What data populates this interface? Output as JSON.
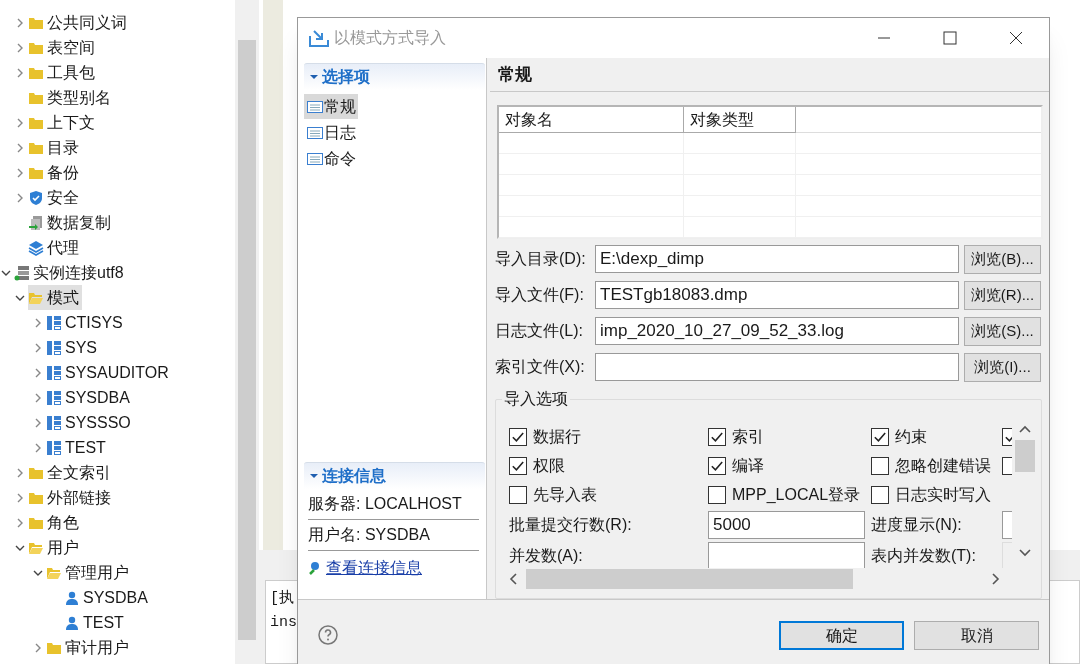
{
  "tree_continued": [
    {
      "label": "公共同义词",
      "kind": "folder",
      "expanded": false,
      "selected": false
    },
    {
      "label": "表空间",
      "kind": "folder",
      "expanded": false,
      "selected": false
    },
    {
      "label": "工具包",
      "kind": "folder",
      "expanded": false,
      "selected": false
    },
    {
      "label": "类型别名",
      "kind": "folder",
      "selected": false
    },
    {
      "label": "上下文",
      "kind": "folder",
      "expanded": false,
      "selected": false
    },
    {
      "label": "目录",
      "kind": "folder",
      "expanded": false,
      "selected": false
    },
    {
      "label": "备份",
      "kind": "folder",
      "expanded": false,
      "selected": false
    },
    {
      "label": "安全",
      "kind": "security",
      "expanded": false,
      "selected": false
    },
    {
      "label": "数据复制",
      "kind": "replication",
      "selected": false
    },
    {
      "label": "代理",
      "kind": "agent",
      "selected": false
    }
  ],
  "tree": [
    {
      "label": "实例连接utf8",
      "kind": "connection",
      "expanded": true,
      "selected": false,
      "children": [
        {
          "label": "模式",
          "kind": "folder",
          "expanded": true,
          "selected": true,
          "children": [
            {
              "label": "CTISYS",
              "kind": "schema",
              "expanded": false,
              "selected": false
            },
            {
              "label": "SYS",
              "kind": "schema",
              "expanded": false,
              "selected": false
            },
            {
              "label": "SYSAUDITOR",
              "kind": "schema",
              "expanded": false,
              "selected": false
            },
            {
              "label": "SYSDBA",
              "kind": "schema",
              "expanded": false,
              "selected": false
            },
            {
              "label": "SYSSSO",
              "kind": "schema",
              "expanded": false,
              "selected": false
            },
            {
              "label": "TEST",
              "kind": "schema",
              "expanded": false,
              "selected": false
            }
          ]
        },
        {
          "label": "全文索引",
          "kind": "folder",
          "expanded": false,
          "selected": false
        },
        {
          "label": "外部链接",
          "kind": "folder",
          "expanded": false,
          "selected": false
        },
        {
          "label": "角色",
          "kind": "folder",
          "expanded": false,
          "selected": false
        },
        {
          "label": "用户",
          "kind": "folder",
          "expanded": true,
          "selected": false,
          "children": [
            {
              "label": "管理用户",
              "kind": "folder",
              "expanded": true,
              "selected": false,
              "children": [
                {
                  "label": "SYSDBA",
                  "kind": "user",
                  "selected": false
                },
                {
                  "label": "TEST",
                  "kind": "user",
                  "selected": false
                }
              ]
            },
            {
              "label": "审计用户",
              "kind": "folder",
              "expanded": false,
              "selected": false
            }
          ]
        }
      ]
    }
  ],
  "console_lines": [
    "[执",
    "ins"
  ],
  "dialog": {
    "title": "以模式方式导入",
    "nav": {
      "title": "选择项",
      "expanded": true,
      "items": [
        {
          "label": "常规",
          "selected": true
        },
        {
          "label": "日志",
          "selected": false
        },
        {
          "label": "命令",
          "selected": false
        }
      ]
    },
    "connection": {
      "title": "连接信息",
      "expanded": true,
      "lines": [
        "服务器: LOCALHOST",
        "用户名: SYSDBA"
      ],
      "link": "查看连接信息"
    },
    "page_title": "常规",
    "table": {
      "columns": [
        "对象名",
        "对象类型"
      ]
    },
    "fields": [
      {
        "label": "导入目录(D):",
        "value": "E:\\dexp_dimp",
        "button": "浏览(B)..."
      },
      {
        "label": "导入文件(F):",
        "value": "TESTgb18083.dmp",
        "button": "浏览(R)..."
      },
      {
        "label": "日志文件(L):",
        "value": "imp_2020_10_27_09_52_33.log",
        "button": "浏览(S)..."
      },
      {
        "label": "索引文件(X):",
        "button": "浏览(I)..."
      }
    ],
    "options_group": {
      "title": "导入选项",
      "checkboxes": [
        {
          "label": "数据行",
          "checked": true
        },
        {
          "label": "索引",
          "checked": true
        },
        {
          "label": "约束",
          "checked": true
        },
        {
          "checked": true
        },
        {
          "label": "权限",
          "checked": true
        },
        {
          "label": "编译",
          "checked": true
        },
        {
          "label": "忽略创建错误",
          "checked": false
        },
        {
          "checked": false
        },
        {
          "label": "先导入表",
          "checked": false
        },
        {
          "label": "MPP_LOCAL登录",
          "checked": false
        },
        {
          "label": "日志实时写入",
          "checked": false
        }
      ],
      "inputs": [
        {
          "label": "批量提交行数(R):",
          "value": "5000",
          "disabled": false
        },
        {
          "label": "进度显示(N):",
          "disabled": false
        },
        {
          "label": "并发数(A):",
          "disabled": false
        },
        {
          "label": "表内并发数(T):",
          "disabled": true
        }
      ]
    },
    "buttons": [
      {
        "label": "确定",
        "default": true
      },
      {
        "label": "取消",
        "default": false
      }
    ]
  }
}
